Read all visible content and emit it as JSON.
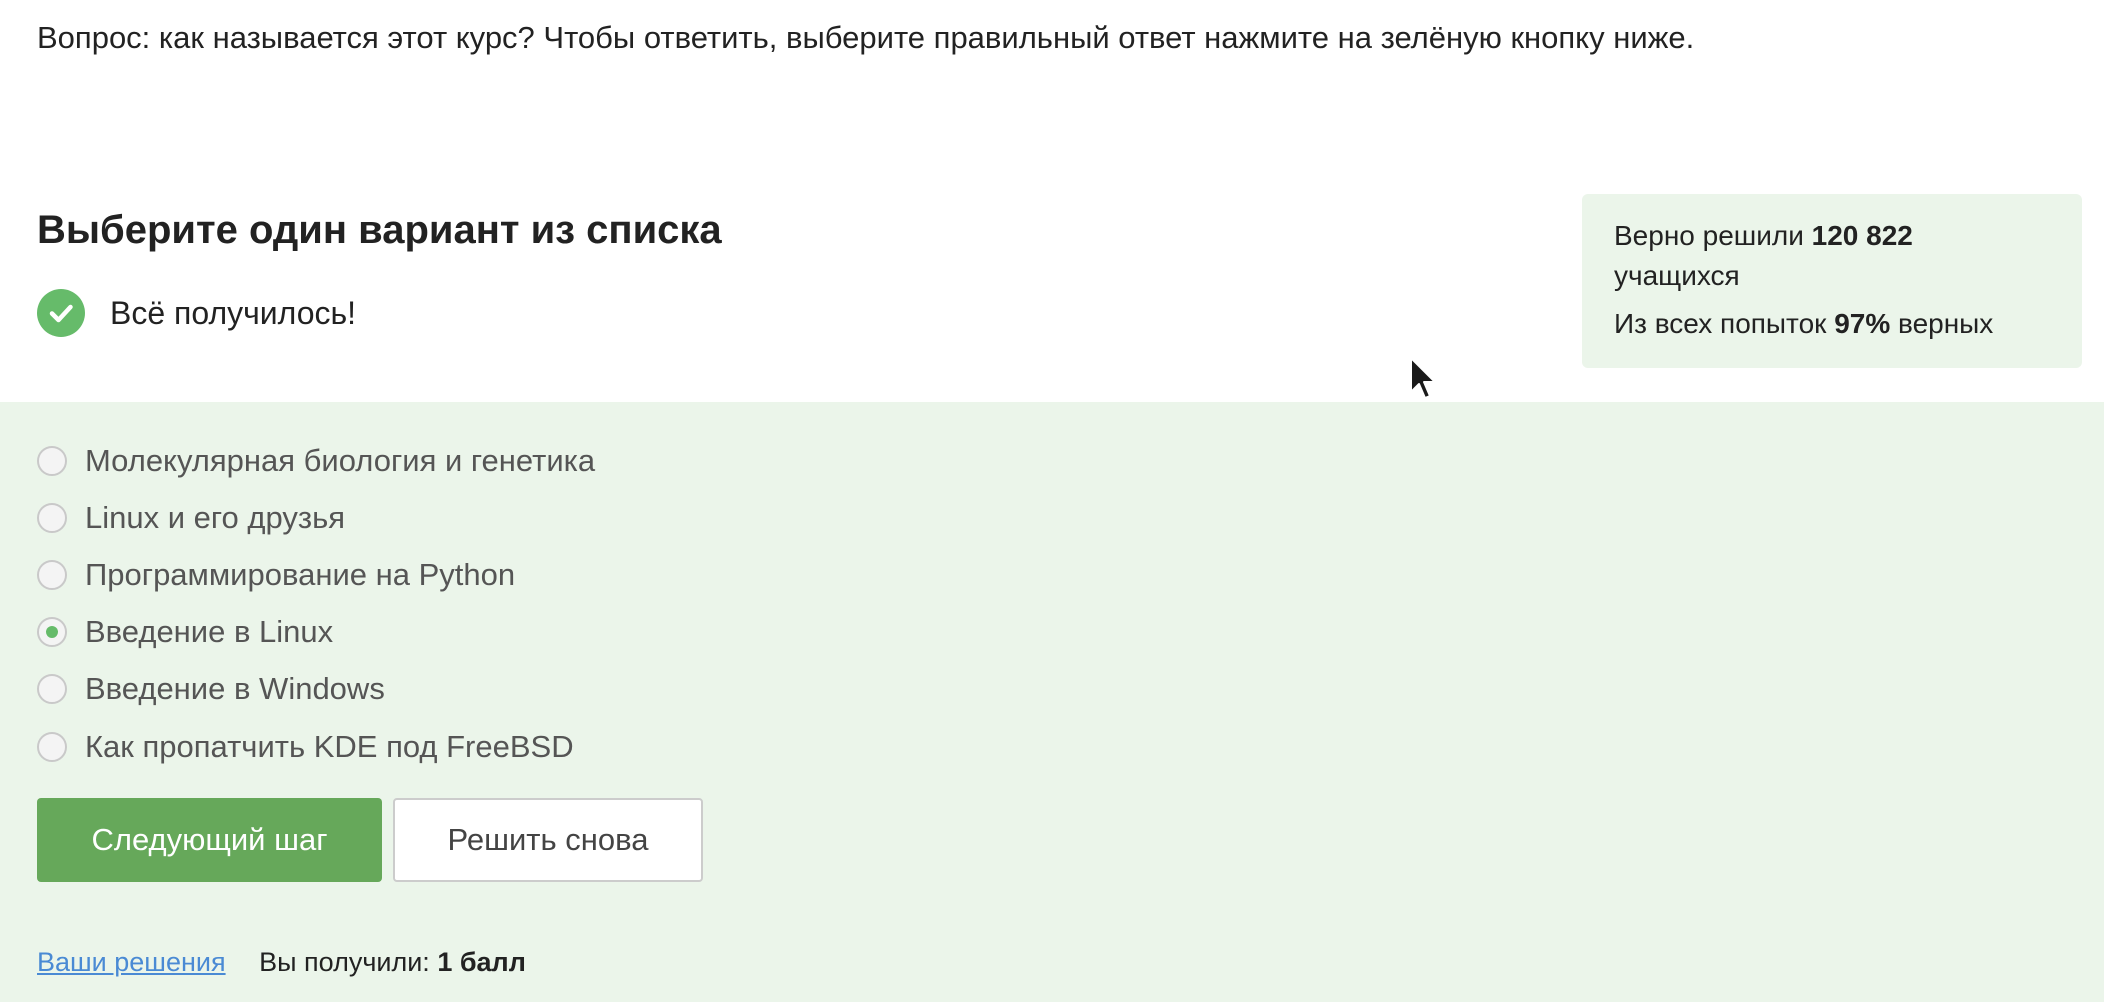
{
  "question": "Вопрос: как называется этот курс? Чтобы ответить, выберите правильный ответ нажмите на зелёную кнопку ниже.",
  "heading": "Выберите один вариант из списка",
  "status": {
    "text": "Всё получилось!",
    "icon": "check-circle-icon",
    "color": "#66bb6a"
  },
  "stats": {
    "solved_prefix": "Верно решили",
    "solved_count": "120 822",
    "solved_suffix": "учащихся",
    "attempts_prefix": "Из всех попыток",
    "attempts_percent": "97%",
    "attempts_suffix": "верных"
  },
  "options": [
    {
      "label": "Молекулярная биология и генетика",
      "selected": false
    },
    {
      "label": "Linux и его друзья",
      "selected": false
    },
    {
      "label": "Программирование на Python",
      "selected": false
    },
    {
      "label": "Введение в Linux",
      "selected": true
    },
    {
      "label": "Введение в Windows",
      "selected": false
    },
    {
      "label": "Как пропатчить KDE под FreeBSD",
      "selected": false
    }
  ],
  "buttons": {
    "next": "Следующий шаг",
    "retry": "Решить снова"
  },
  "footer": {
    "solutions_link": "Ваши решения",
    "score_prefix": "Вы получили:",
    "score_value": "1 балл"
  },
  "colors": {
    "accent": "#66a85a",
    "panel_bg": "#ebf5ea",
    "link": "#4a8ad4"
  }
}
